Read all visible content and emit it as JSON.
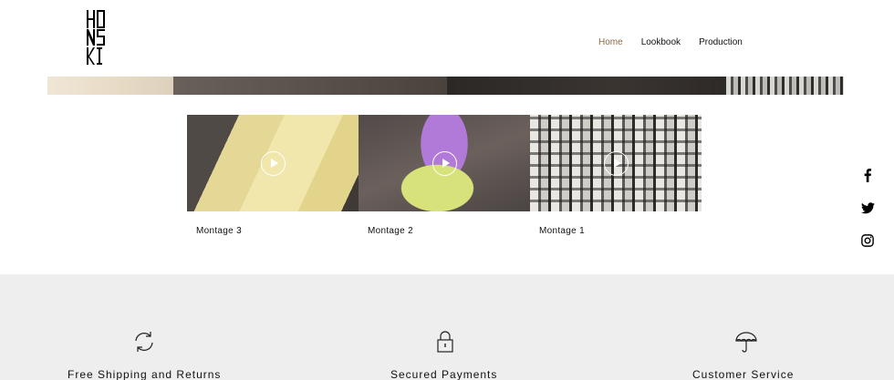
{
  "header": {
    "logo_text": "HONSKI",
    "nav": [
      {
        "label": "Home",
        "active": true
      },
      {
        "label": "Lookbook",
        "active": false
      },
      {
        "label": "Production",
        "active": false
      }
    ]
  },
  "videos": [
    {
      "title": "Montage 3"
    },
    {
      "title": "Montage 2"
    },
    {
      "title": "Montage 1"
    }
  ],
  "social": [
    {
      "icon": "facebook-icon"
    },
    {
      "icon": "twitter-icon"
    },
    {
      "icon": "instagram-icon"
    }
  ],
  "features": [
    {
      "icon": "refresh-icon",
      "label": "Free Shipping and Returns"
    },
    {
      "icon": "lock-icon",
      "label": "Secured Payments"
    },
    {
      "icon": "umbrella-icon",
      "label": "Customer Service"
    }
  ],
  "colors": {
    "nav_active": "#8a6a47",
    "band_bg": "#eeeeee"
  }
}
